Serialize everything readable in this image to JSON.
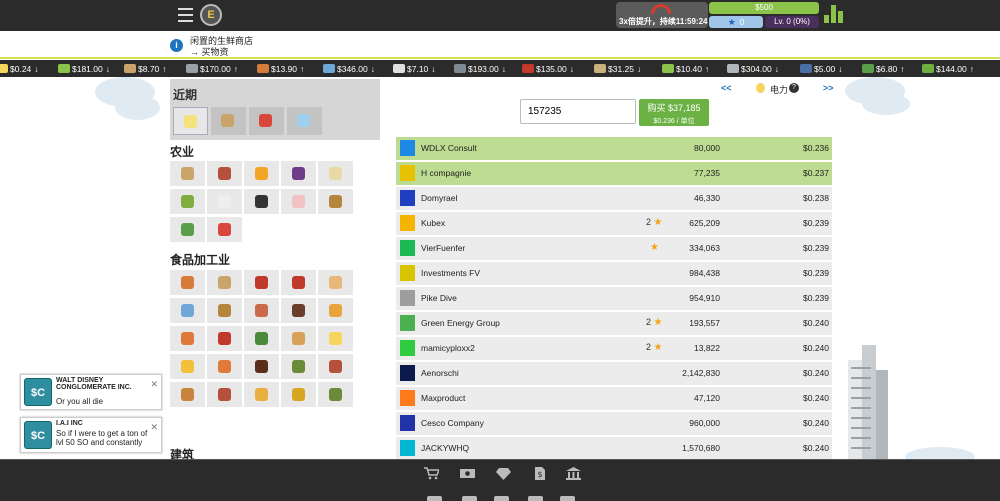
{
  "header": {
    "menu_icon": "hamburger-menu-icon",
    "logo_text": "E",
    "boost_text": "3x倍提升，持续11:59:24",
    "money": "$500",
    "gems": "0",
    "level": "Lv. 0 (0%)",
    "colors": {
      "bar": "#2b2b2b",
      "money": "#8bc34a",
      "gems": "#9fc6e8",
      "level": "#4a2e5e",
      "accent": "#d4e157"
    }
  },
  "notice": {
    "icon": "info-icon",
    "line1": "闲置的生鲜商店",
    "line2": "→ 买物资"
  },
  "ticker": [
    {
      "price": "$0.24",
      "dir": "↓",
      "icon": "power-icon"
    },
    {
      "price": "$181.00",
      "dir": "↓",
      "icon": "plant-icon"
    },
    {
      "price": "$8.70",
      "dir": "↑",
      "icon": "wood-icon"
    },
    {
      "price": "$170.00",
      "dir": "↑",
      "icon": "steel-icon"
    },
    {
      "price": "$13.90",
      "dir": "↑",
      "icon": "gear-icon"
    },
    {
      "price": "$346.00",
      "dir": "↓",
      "icon": "truck-icon"
    },
    {
      "price": "$7.10",
      "dir": "↓",
      "icon": "paper-icon"
    },
    {
      "price": "$193.00",
      "dir": "↓",
      "icon": "gun-icon"
    },
    {
      "price": "$135.00",
      "dir": "↓",
      "icon": "car-icon"
    },
    {
      "price": "$31.25",
      "dir": "↓",
      "icon": "goods-icon"
    },
    {
      "price": "$10.40",
      "dir": "↑",
      "icon": "leaf-icon"
    },
    {
      "price": "$304.00",
      "dir": "↓",
      "icon": "metal-icon"
    },
    {
      "price": "$5.00",
      "dir": "↓",
      "icon": "ship-icon"
    },
    {
      "price": "$6.80",
      "dir": "↑",
      "icon": "tree-icon"
    },
    {
      "price": "$144.00",
      "dir": "↑",
      "icon": "bush-icon"
    }
  ],
  "left": {
    "recent_title": "近期",
    "recent": [
      "lightbulb-icon",
      "seeds-icon",
      "steak-icon",
      "water-icon"
    ],
    "agri_title": "农业",
    "food_title": "食品加工业",
    "next_title": "建筑"
  },
  "market": {
    "prev": "<<",
    "next": ">>",
    "resource_name": "电力",
    "help": "?",
    "quantity": "157235",
    "buy_label": "购买 $37,185",
    "unit_price": "$0.236 / 单位",
    "rows": [
      {
        "name": "WDLX Consult",
        "stars": "",
        "qty": "80,000",
        "price": "$0.236",
        "highlight": true,
        "logo": "#1e88e5"
      },
      {
        "name": "H compagnie",
        "stars": "",
        "qty": "77,235",
        "price": "$0.237",
        "highlight": true,
        "logo": "#e6c200"
      },
      {
        "name": "Domyrael",
        "stars": "",
        "qty": "46,330",
        "price": "$0.238",
        "highlight": false,
        "logo": "#1e3fbf"
      },
      {
        "name": "Kubex",
        "stars": "2",
        "qty": "625,209",
        "price": "$0.239",
        "highlight": false,
        "logo": "#f4b400"
      },
      {
        "name": "VierFuenfer",
        "stars": "★",
        "qty": "334,063",
        "price": "$0.239",
        "highlight": false,
        "logo": "#1db954"
      },
      {
        "name": "Investments FV",
        "stars": "",
        "qty": "984,438",
        "price": "$0.239",
        "highlight": false,
        "logo": "#d8c500"
      },
      {
        "name": "Pike Dive",
        "stars": "",
        "qty": "954,910",
        "price": "$0.239",
        "highlight": false,
        "logo": "#9e9e9e"
      },
      {
        "name": "Green Energy Group",
        "stars": "2",
        "qty": "193,557",
        "price": "$0.240",
        "highlight": false,
        "logo": "#4caf50"
      },
      {
        "name": "mamicyploxx2",
        "stars": "2",
        "qty": "13,822",
        "price": "$0.240",
        "highlight": false,
        "logo": "#2ecc40"
      },
      {
        "name": "Aenorschi",
        "stars": "",
        "qty": "2,142,830",
        "price": "$0.240",
        "highlight": false,
        "logo": "#0d1b4c"
      },
      {
        "name": "Maxproduct",
        "stars": "",
        "qty": "47,120",
        "price": "$0.240",
        "highlight": false,
        "logo": "#ff7a1a"
      },
      {
        "name": "Cesco Company",
        "stars": "",
        "qty": "960,000",
        "price": "$0.240",
        "highlight": false,
        "logo": "#2233aa"
      },
      {
        "name": "JACKYWHQ",
        "stars": "",
        "qty": "1,570,680",
        "price": "$0.240",
        "highlight": false,
        "logo": "#00b8d4"
      }
    ]
  },
  "chat": [
    {
      "company": "WALT DISNEY CONGLOMERATE INC.",
      "message": "Or you all die",
      "avatar": "$C"
    },
    {
      "company": "I.A.I INC",
      "message": "So if I were to get a ton of lvl 50 SO and constantly",
      "avatar": "$C"
    }
  ],
  "bottom": [
    "cart-icon",
    "cash-icon",
    "diamond-icon",
    "document-dollar-icon",
    "bank-icon"
  ]
}
